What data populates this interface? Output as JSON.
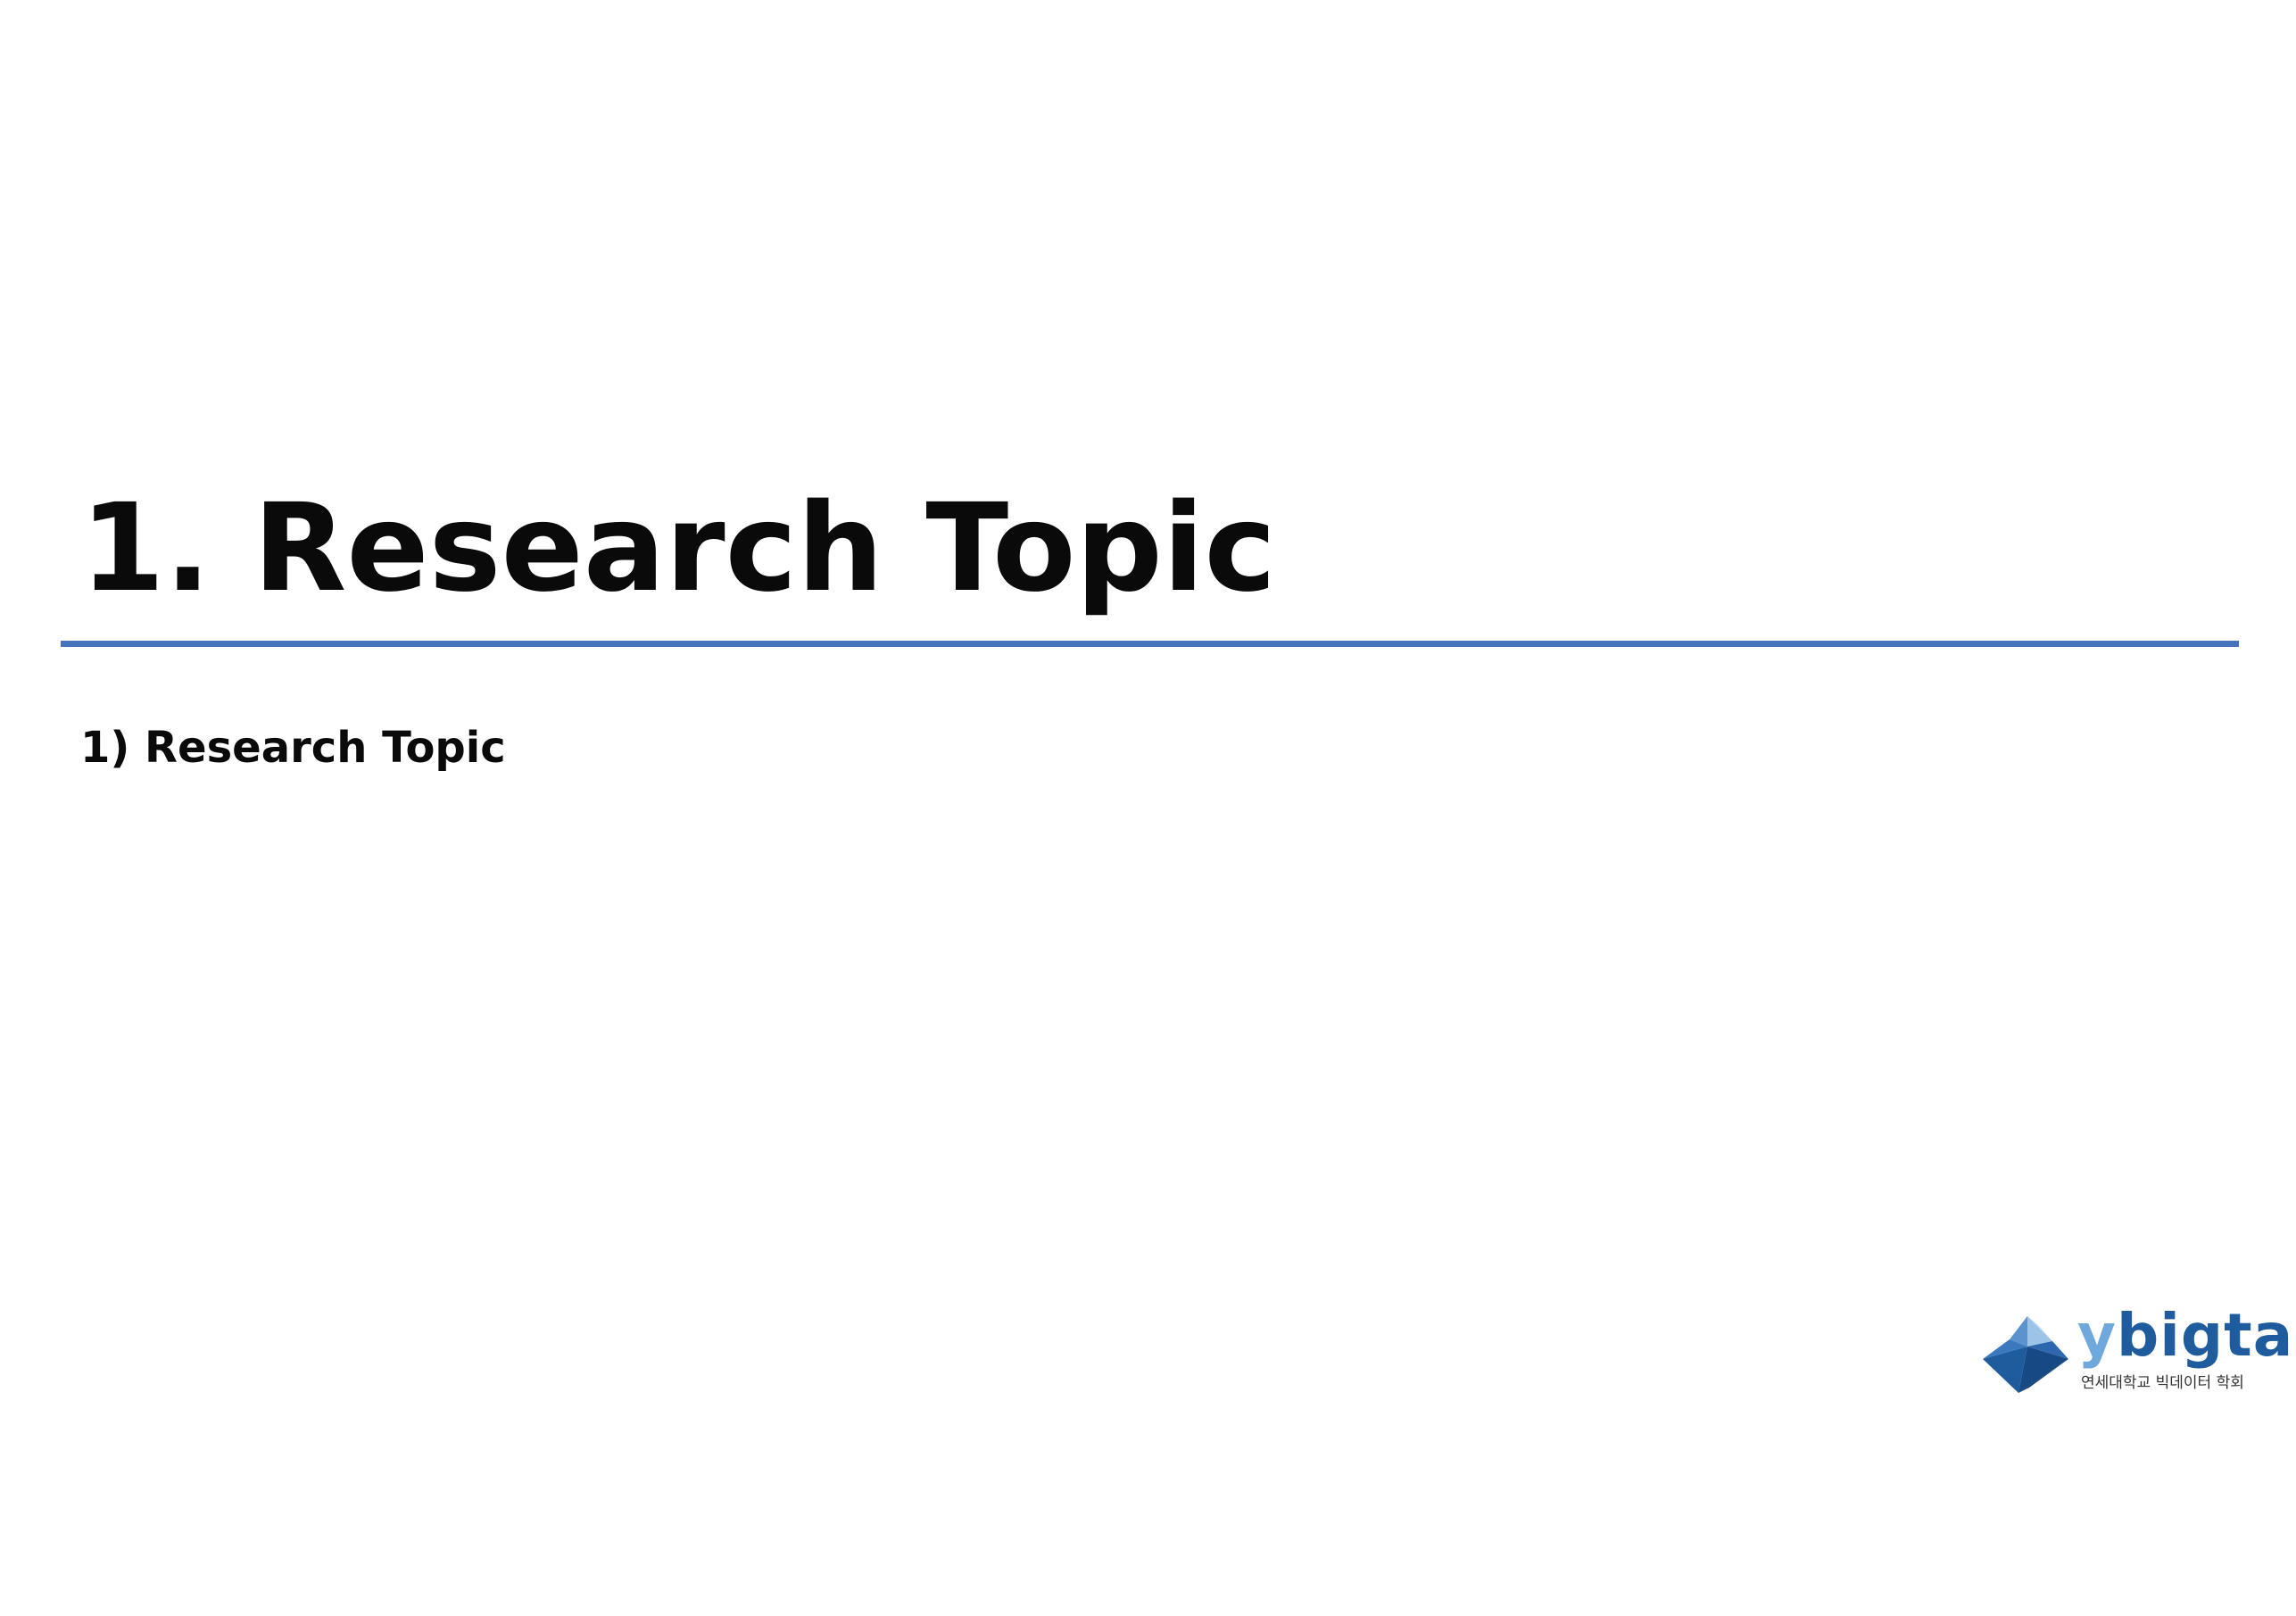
{
  "slide": {
    "title": "1. Research Topic",
    "subtitle": "1) Research Topic"
  },
  "logo": {
    "wordmark_first": "y",
    "wordmark_rest": "bigta",
    "tagline": "연세대학교 빅데이터 학회"
  },
  "colors": {
    "rule": "#4574bd",
    "title_text": "#0a0a0a",
    "logo_dark_blue": "#1f5c9e",
    "logo_light_blue": "#6fa8dc"
  }
}
